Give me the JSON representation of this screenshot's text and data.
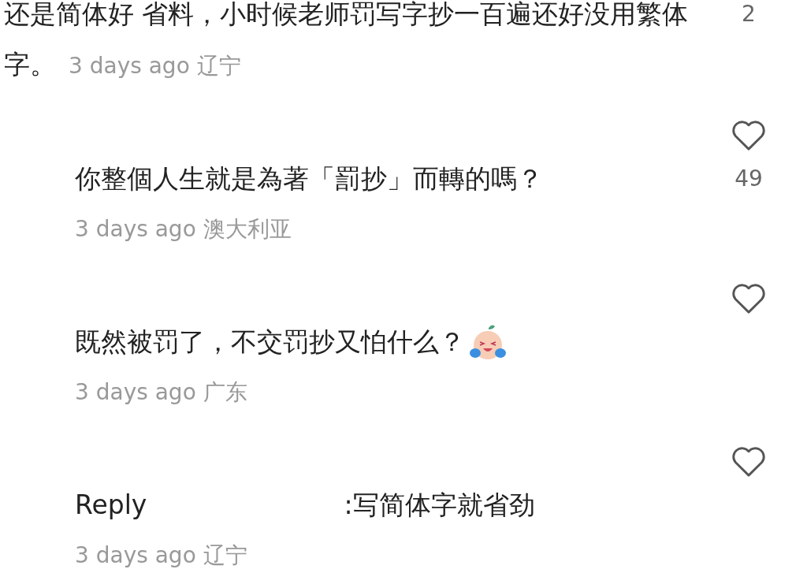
{
  "comment": {
    "text": "还是简体好 省料，小时候老师罚写字抄一百遍还好没用繁体字。",
    "time": "3 days ago",
    "location": "辽宁",
    "likes": "2"
  },
  "replies": [
    {
      "kind": "text",
      "text": "你整個人生就是為著「罰抄」而轉的嗎？",
      "time": "3 days ago",
      "location": "澳大利亚",
      "likes": "49",
      "liked": false
    },
    {
      "kind": "emoji",
      "text": "既然被罚了，不交罚抄又怕什么？",
      "time": "3 days ago",
      "location": "广东",
      "liked": false
    },
    {
      "kind": "reply_to",
      "prefix": "Reply",
      "text": ":写简体字就省劲",
      "time": "3 days ago",
      "location": "辽宁",
      "liked": false
    }
  ]
}
